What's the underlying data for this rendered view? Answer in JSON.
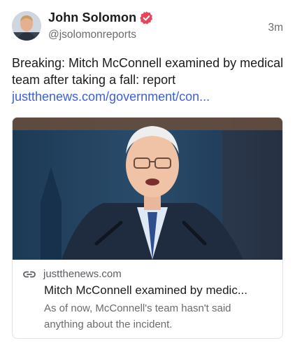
{
  "author": {
    "display_name": "John Solomon",
    "handle": "@jsolomonreports",
    "verified_icon": "verified-badge-icon",
    "avatar_icon": "avatar"
  },
  "post": {
    "timestamp": "3m",
    "text": "Breaking: Mitch McConnell examined by medical team after taking a fall: report",
    "link_text": "justthenews.com/government/con..."
  },
  "card": {
    "domain": "justthenews.com",
    "link_icon": "link-icon",
    "title": "Mitch McConnell examined by medic...",
    "description": "As of now, McConnell's team hasn't said anything about the incident."
  },
  "colors": {
    "link": "#3d5fd8",
    "verified": "#e2475d",
    "secondary_text": "#6b6b70",
    "card_border": "#e3e3e7"
  }
}
